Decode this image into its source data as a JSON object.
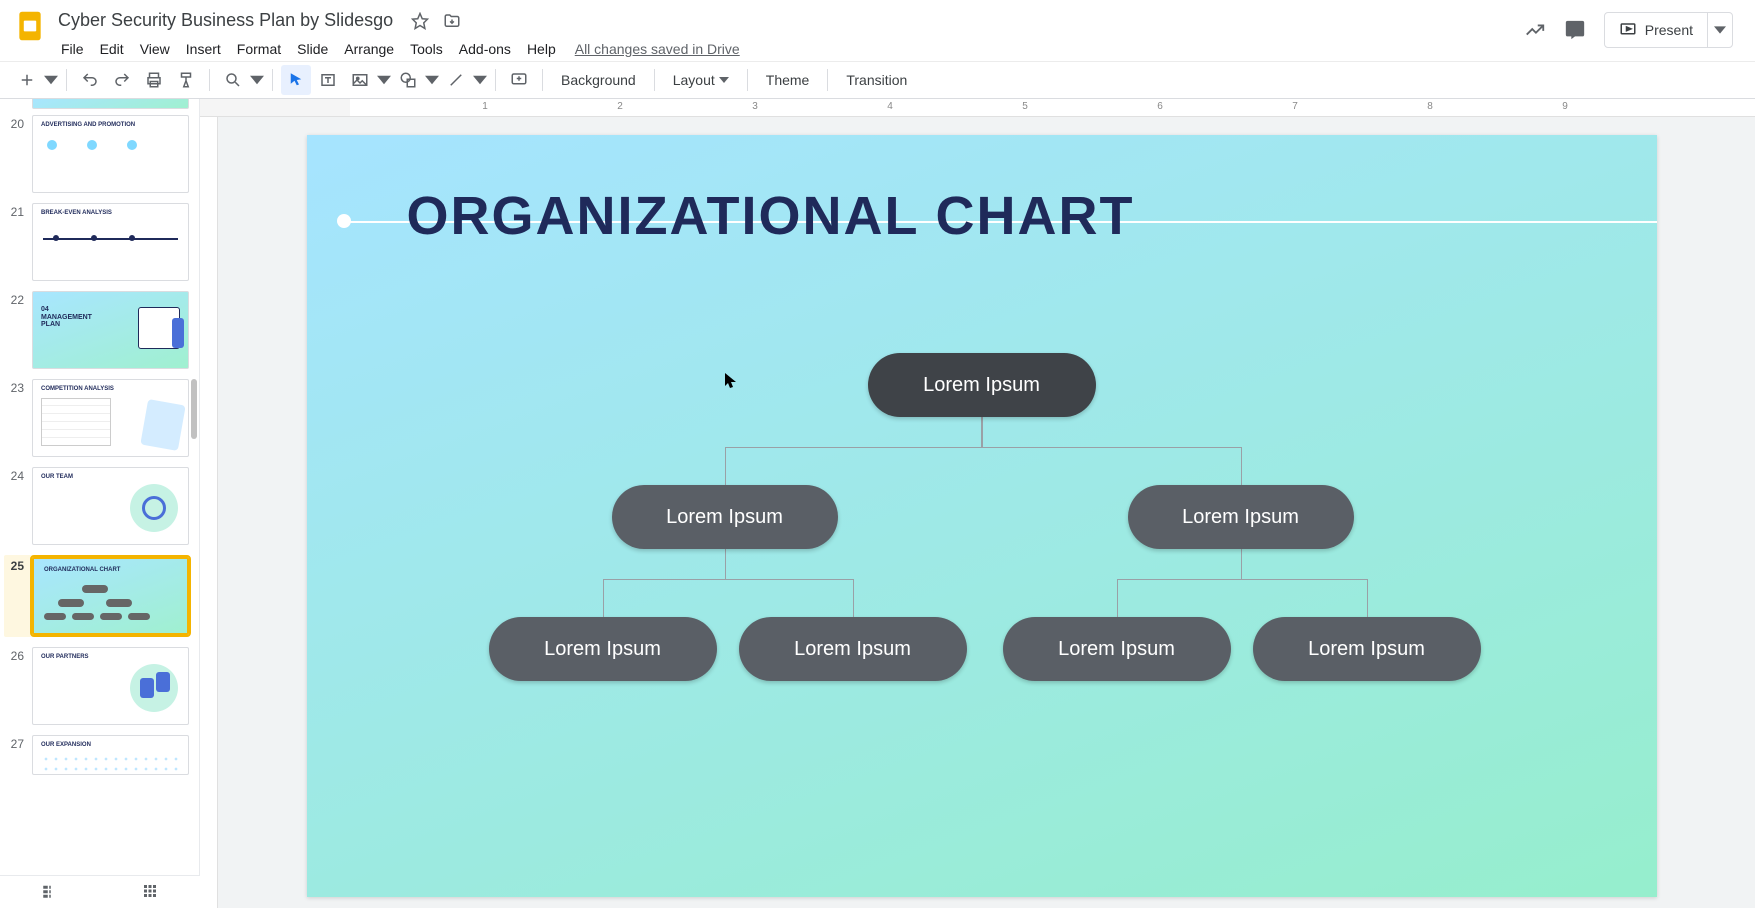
{
  "doc": {
    "title": "Cyber Security Business Plan by Slidesgo"
  },
  "menu": {
    "file": "File",
    "edit": "Edit",
    "view": "View",
    "insert": "Insert",
    "format": "Format",
    "slide": "Slide",
    "arrange": "Arrange",
    "tools": "Tools",
    "addons": "Add-ons",
    "help": "Help"
  },
  "save_status": "All changes saved in Drive",
  "present": {
    "label": "Present"
  },
  "toolbar": {
    "background": "Background",
    "layout": "Layout",
    "theme": "Theme",
    "transition": "Transition"
  },
  "ruler": {
    "marks": [
      "1",
      "2",
      "3",
      "4",
      "5",
      "6",
      "7",
      "8",
      "9"
    ]
  },
  "filmstrip": {
    "slides": [
      {
        "num": "20",
        "title": "ADVERTISING AND PROMOTION",
        "bg": "white"
      },
      {
        "num": "21",
        "title": "BREAK-EVEN ANALYSIS",
        "bg": "white"
      },
      {
        "num": "22",
        "title": "04 MANAGEMENT PLAN",
        "bg": "gradient"
      },
      {
        "num": "23",
        "title": "COMPETITION ANALYSIS",
        "bg": "white"
      },
      {
        "num": "24",
        "title": "OUR TEAM",
        "bg": "white"
      },
      {
        "num": "25",
        "title": "ORGANIZATIONAL CHART",
        "bg": "gradient",
        "selected": true
      },
      {
        "num": "26",
        "title": "OUR PARTNERS",
        "bg": "white"
      },
      {
        "num": "27",
        "title": "OUR EXPANSION",
        "bg": "white"
      }
    ]
  },
  "slide": {
    "title": "ORGANIZATIONAL CHART",
    "nodes": {
      "root": "Lorem Ipsum",
      "left": "Lorem Ipsum",
      "right": "Lorem Ipsum",
      "leaf1": "Lorem Ipsum",
      "leaf2": "Lorem Ipsum",
      "leaf3": "Lorem Ipsum",
      "leaf4": "Lorem Ipsum"
    }
  },
  "chart_data": {
    "type": "diagram",
    "subtype": "org-chart",
    "title": "ORGANIZATIONAL CHART",
    "tree": {
      "label": "Lorem Ipsum",
      "children": [
        {
          "label": "Lorem Ipsum",
          "children": [
            {
              "label": "Lorem Ipsum"
            },
            {
              "label": "Lorem Ipsum"
            }
          ]
        },
        {
          "label": "Lorem Ipsum",
          "children": [
            {
              "label": "Lorem Ipsum"
            },
            {
              "label": "Lorem Ipsum"
            }
          ]
        }
      ]
    }
  }
}
